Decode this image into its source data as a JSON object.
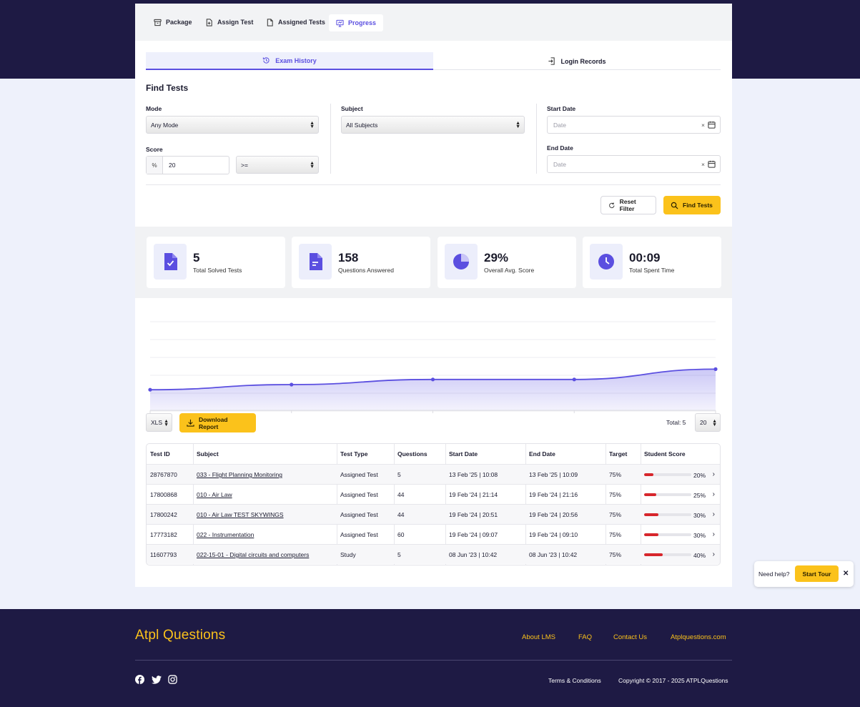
{
  "colors": {
    "navy": "#1e1a44",
    "accent": "#5b4fe0",
    "yellow": "#fbc21b",
    "danger": "#d7262c"
  },
  "tabs": [
    {
      "label": "Package",
      "icon": "package-icon"
    },
    {
      "label": "Assign Test",
      "icon": "assign-file-icon"
    },
    {
      "label": "Assigned Tests",
      "icon": "file-icon"
    },
    {
      "label": "Progress",
      "icon": "progress-icon",
      "active": true
    }
  ],
  "subtabs": [
    {
      "label": "Exam History",
      "icon": "history-icon",
      "active": true
    },
    {
      "label": "Login Records",
      "icon": "login-icon"
    }
  ],
  "filters": {
    "title": "Find Tests",
    "mode_label": "Mode",
    "mode_value": "Any Mode",
    "subject_label": "Subject",
    "subject_value": "All Subjects",
    "start_label": "Start Date",
    "start_placeholder": "Date",
    "end_label": "End Date",
    "end_placeholder": "Date",
    "score_label": "Score",
    "score_prefix": "%",
    "score_value": "20",
    "score_op": ">=",
    "clear_symbol": "×",
    "reset_label": "Reset Filter",
    "find_label": "Find Tests"
  },
  "stats": [
    {
      "value": "5",
      "caption": "Total Solved Tests",
      "icon": "solved-file-icon"
    },
    {
      "value": "158",
      "caption": "Questions Answered",
      "icon": "document-icon"
    },
    {
      "value": "29%",
      "caption": "Overall Avg. Score",
      "icon": "pie-icon"
    },
    {
      "value": "00:09",
      "caption": "Total Spent Time",
      "icon": "clock-icon"
    }
  ],
  "chart_data": {
    "type": "area",
    "values": [
      20,
      25,
      30,
      30,
      40
    ],
    "ylim": [
      0,
      100
    ],
    "grid": true
  },
  "report": {
    "format": "XLS",
    "download_label": "Download Report",
    "total_label": "Total: 5",
    "page_size": "20"
  },
  "table": {
    "headers": [
      "Test ID",
      "Subject",
      "Test Type",
      "Questions",
      "Start Date",
      "End Date",
      "Target",
      "Student Score"
    ],
    "rows": [
      {
        "id": "28767870",
        "subject": "033 - Flight Planning Monitoring",
        "type": "Assigned Test",
        "questions": "5",
        "start": "13 Feb '25 | 10:08",
        "end": "13 Feb '25 | 10:09",
        "target": "75%",
        "score": "20%",
        "score_value": 20
      },
      {
        "id": "17800868",
        "subject": "010 - Air Law",
        "type": "Assigned Test",
        "questions": "44",
        "start": "19 Feb '24 | 21:14",
        "end": "19 Feb '24 | 21:16",
        "target": "75%",
        "score": "25%",
        "score_value": 25
      },
      {
        "id": "17800242",
        "subject": "010 - Air Law TEST SKYWINGS",
        "type": "Assigned Test",
        "questions": "44",
        "start": "19 Feb '24 | 20:51",
        "end": "19 Feb '24 | 20:56",
        "target": "75%",
        "score": "30%",
        "score_value": 30
      },
      {
        "id": "17773182",
        "subject": "022 - Instrumentation",
        "type": "Assigned Test",
        "questions": "60",
        "start": "19 Feb '24 | 09:07",
        "end": "19 Feb '24 | 09:10",
        "target": "75%",
        "score": "30%",
        "score_value": 30
      },
      {
        "id": "11607793",
        "subject": "022-15-01 - Digital circuits and computers",
        "type": "Study",
        "questions": "5",
        "start": "08 Jun '23 | 10:42",
        "end": "08 Jun '23 | 10:42",
        "target": "75%",
        "score": "40%",
        "score_value": 40
      }
    ]
  },
  "help": {
    "label": "Need help?",
    "button": "Start Tour",
    "close": "✕"
  },
  "footer": {
    "brand": "Atpl Questions",
    "links": [
      "About LMS",
      "FAQ",
      "Contact Us",
      "Atplquestions.com"
    ],
    "terms": "Terms & Conditions",
    "copyright": "Copyright © 2017 - 2025 ATPLQuestions",
    "social": [
      "facebook-icon",
      "twitter-icon",
      "instagram-icon"
    ]
  }
}
